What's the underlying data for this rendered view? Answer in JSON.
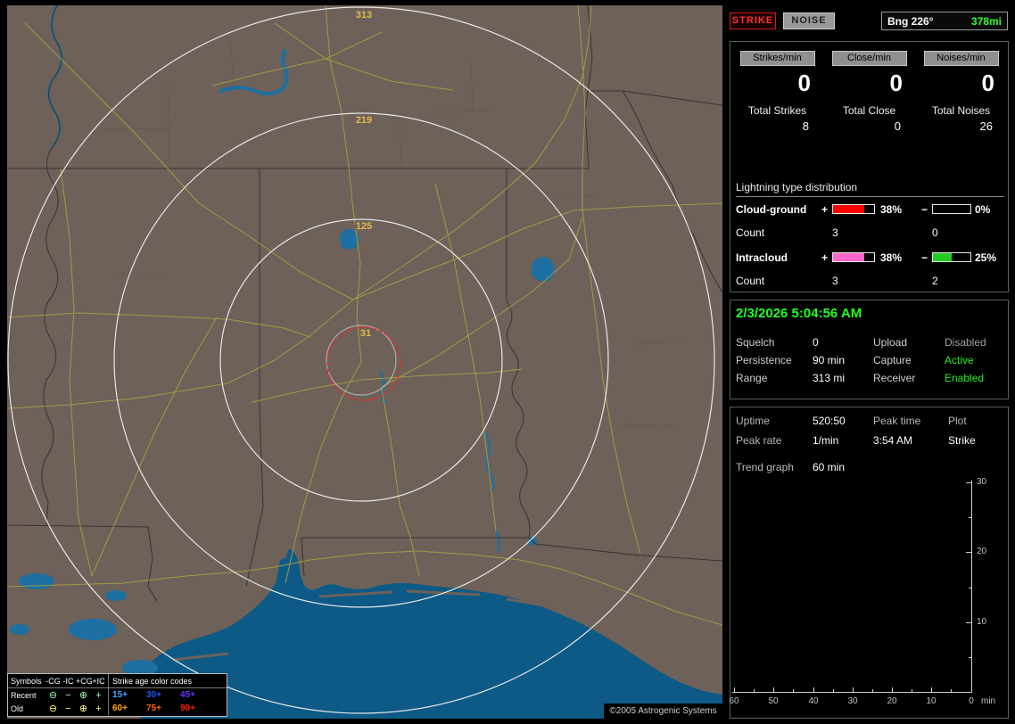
{
  "map": {
    "rings": [
      "313",
      "219",
      "125",
      "31"
    ],
    "copyright": "©2005 Astrogenic Systems",
    "legend": {
      "symbols_header": "Symbols",
      "age_header": "Strike age color codes",
      "columns": [
        "-CG",
        "-IC",
        "+CG",
        "+IC"
      ],
      "rows": [
        {
          "label": "Recent",
          "symbols": [
            "⊖",
            "−",
            "⊕",
            "+"
          ],
          "symbol_color": "#9fffb0",
          "ages": [
            {
              "label": "15+",
              "color": "#44aaff"
            },
            {
              "label": "30+",
              "color": "#2255ff"
            },
            {
              "label": "45+",
              "color": "#6633ff"
            }
          ]
        },
        {
          "label": "Old",
          "symbols": [
            "⊖",
            "−",
            "⊕",
            "+"
          ],
          "symbol_color": "#ffff66",
          "ages": [
            {
              "label": "60+",
              "color": "#ffaa00"
            },
            {
              "label": "75+",
              "color": "#ff6600"
            },
            {
              "label": "90+",
              "color": "#ff2200"
            }
          ]
        }
      ]
    }
  },
  "panel": {
    "strike_button": "STRIKE",
    "noise_button": "NOISE",
    "bearing": {
      "label": "Bng 226°",
      "value": "378mi",
      "value_color": "#33ff33"
    },
    "rates": [
      {
        "label": "Strikes/min",
        "value": "0",
        "total_label": "Total Strikes",
        "total": "8"
      },
      {
        "label": "Close/min",
        "value": "0",
        "total_label": "Total Close",
        "total": "0"
      },
      {
        "label": "Noises/min",
        "value": "0",
        "total_label": "Total Noises",
        "total": "26"
      }
    ],
    "distribution": {
      "header": "Lightning type distribution",
      "rows": [
        {
          "name": "Cloud-ground",
          "pos_sign": "+",
          "pos_pct": "38%",
          "pos_fill": 76,
          "pos_color": "#ff0000",
          "neg_sign": "−",
          "neg_pct": "0%",
          "neg_fill": 0,
          "neg_color": "#ff0000",
          "count_label": "Count",
          "pos_count": "3",
          "neg_count": "0"
        },
        {
          "name": "Intracloud",
          "pos_sign": "+",
          "pos_pct": "38%",
          "pos_fill": 76,
          "pos_color": "#ff66cc",
          "neg_sign": "−",
          "neg_pct": "25%",
          "neg_fill": 50,
          "neg_color": "#22cc22",
          "count_label": "Count",
          "pos_count": "3",
          "neg_count": "2"
        }
      ]
    },
    "status": {
      "datetime": "2/3/2026 5:04:56 AM",
      "rows": [
        {
          "label1": "Squelch",
          "value1": "0",
          "label2": "Upload",
          "value2": "Disabled",
          "value2_color": "#a0a0a0"
        },
        {
          "label1": "Persistence",
          "value1": "90 min",
          "label2": "Capture",
          "value2": "Active",
          "value2_color": "#22ee22"
        },
        {
          "label1": "Range",
          "value1": "313 mi",
          "label2": "Receiver",
          "value2": "Enabled",
          "value2_color": "#22ee22"
        }
      ]
    },
    "session": {
      "uptime_label": "Uptime",
      "uptime_value": "520:50",
      "peak_time_label": "Peak time",
      "plot_label": "Plot",
      "peak_rate_label": "Peak rate",
      "peak_rate_value": "1/min",
      "peak_time_value": "3:54 AM",
      "plot_value": "Strike",
      "trend_label": "Trend graph",
      "trend_value": "60 min"
    },
    "trend": {
      "y_ticks": [
        "30",
        "20",
        "10"
      ],
      "x_ticks": [
        "60",
        "50",
        "40",
        "30",
        "20",
        "10",
        "0"
      ],
      "unit": "min"
    }
  }
}
